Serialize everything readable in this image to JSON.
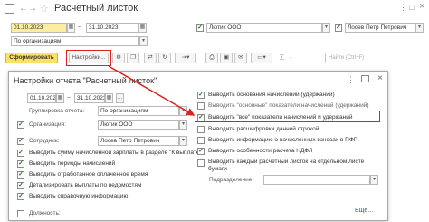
{
  "titlebar": {
    "title": "Расчетный листок",
    "more": "⋮",
    "maximize": "□",
    "close": "×"
  },
  "filters": {
    "date_from": "01.10.2023",
    "date_to": "31.10.2023",
    "date_sep": "–",
    "organization": "Лютик ООО",
    "employee": "Лосев Петр Петрович",
    "grouping": "По организациям"
  },
  "toolbar": {
    "generate": "Сформировать",
    "settings": "Настройки...",
    "search_placeholder": "Найти (Ctrl+F)",
    "sigma": "Σ",
    "minus": "-"
  },
  "dialog": {
    "title": "Настройки отчета \"Расчетный листок\"",
    "date_from": "01.10.2023",
    "date_to": "31.10.2023",
    "grouping_label": "Группировка отчета:",
    "grouping_value": "По организациям",
    "org_label": "Организация:",
    "org_value": "Лютик ООО",
    "emp_label": "Сотрудник:",
    "emp_value": "Лосев Петр Петрович",
    "left_options": [
      {
        "label": "Выводить сумму начисленной зарплаты в разделе \"К выплате\"",
        "checked": true
      },
      {
        "label": "Выводить периоды начислений",
        "checked": true
      },
      {
        "label": "Выводить отработанное оплаченное время",
        "checked": true
      },
      {
        "label": "Детализировать выплаты по ведомостям",
        "checked": true
      },
      {
        "label": "Выводить справочную информацию",
        "checked": true
      }
    ],
    "position_label": "Должность:",
    "right_options": [
      {
        "label": "Выводить основания начислений (удержаний)",
        "checked": true
      },
      {
        "label": "Выводить \"основные\" показатели начислений (удержаний)",
        "checked": false
      },
      {
        "label": "Выводить \"все\" показатели начислений и удержаний",
        "checked": true
      },
      {
        "label": "Выводить расшифровки данной строкой",
        "checked": false
      },
      {
        "label": "Выводить информацию о начисленных взносах в ПФР",
        "checked": false
      },
      {
        "label": "Выводить особенности расчета НДФЛ",
        "checked": true
      },
      {
        "label": "Выводить каждый расчетный листок на отдельном листе бумаги",
        "checked": false
      }
    ],
    "subdivision_label": "Подразделение:",
    "more_label": "Еще..."
  },
  "colors": {
    "accent_yellow": "#fbe165",
    "highlight_red": "#e0201c",
    "check_green": "#1c7a1c"
  }
}
